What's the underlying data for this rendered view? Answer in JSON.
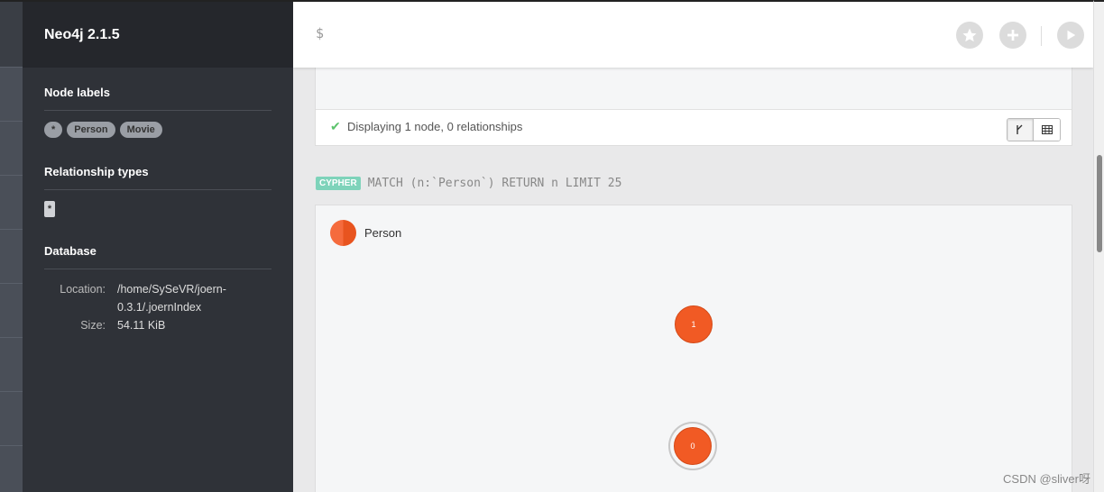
{
  "app": {
    "title": "Neo4j 2.1.5"
  },
  "sidebar": {
    "node_labels_title": "Node labels",
    "node_labels": [
      "*",
      "Person",
      "Movie"
    ],
    "relationship_types_title": "Relationship types",
    "relationship_types": [
      "*"
    ],
    "database_title": "Database",
    "database": {
      "location_key": "Location:",
      "location_value_line1": "/home/SySeVR/joern-",
      "location_value_line2": "0.3.1/.joernIndex",
      "size_key": "Size:",
      "size_value": "54.11 KiB"
    }
  },
  "editor": {
    "prompt": "$",
    "favorite_icon": "star-icon",
    "add_icon": "plus-icon",
    "run_icon": "play-icon"
  },
  "frames": [
    {
      "status_text": "Displaying 1 node, 0 relationships",
      "status_icon": "check-icon",
      "view_graph_icon": "graph-icon",
      "view_table_icon": "table-icon"
    },
    {
      "query_tag": "CYPHER",
      "query": "MATCH (n:`Person`) RETURN n LIMIT 25",
      "legend_label": "Person",
      "nodes": [
        {
          "id": "1"
        },
        {
          "id": "0"
        }
      ]
    }
  ],
  "watermark": "CSDN @sliver呀",
  "colors": {
    "node": "#f15a24",
    "cypher_tag": "#7ed3ba",
    "sidebar_bg": "#2f3238",
    "check": "#5cc36c"
  }
}
